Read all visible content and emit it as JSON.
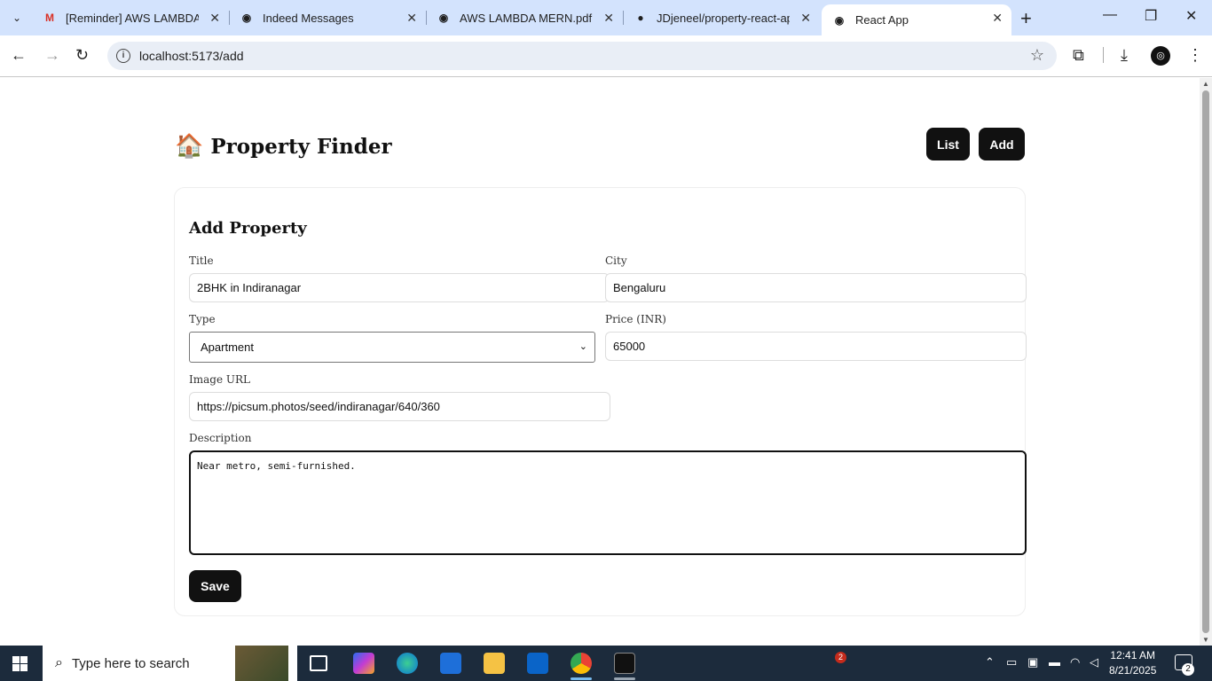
{
  "browser": {
    "tabs": [
      {
        "label": "[Reminder] AWS LAMBDA M",
        "icon": "gmail-icon"
      },
      {
        "label": "Indeed Messages",
        "icon": "globe-icon"
      },
      {
        "label": "AWS LAMBDA MERN.pdf",
        "icon": "globe-icon"
      },
      {
        "label": "JDjeneel/property-react-app",
        "icon": "github-icon"
      },
      {
        "label": "React App",
        "icon": "globe-icon"
      }
    ],
    "url": "localhost:5173/add"
  },
  "app": {
    "brand": "Property Finder",
    "brand_icon": "🏠",
    "nav": {
      "list": "List",
      "add": "Add"
    }
  },
  "form": {
    "heading": "Add Property",
    "title_label": "Title",
    "title_value": "2BHK in Indiranagar",
    "city_label": "City",
    "city_value": "Bengaluru",
    "type_label": "Type",
    "type_value": "Apartment",
    "price_label": "Price (INR)",
    "price_value": "65000",
    "image_label": "Image URL",
    "image_value": "https://picsum.photos/seed/indiranagar/640/360",
    "desc_label": "Description",
    "desc_value": "Near metro, semi-furnished.",
    "save": "Save"
  },
  "taskbar": {
    "search_placeholder": "Type here to search",
    "time": "12:41 AM",
    "date": "8/21/2025",
    "notification_count": "2",
    "mail_badge": "2"
  },
  "colors": {
    "tabstrip": "#d3e3fd",
    "button": "#111111",
    "taskbar": "#1c2b3c"
  }
}
